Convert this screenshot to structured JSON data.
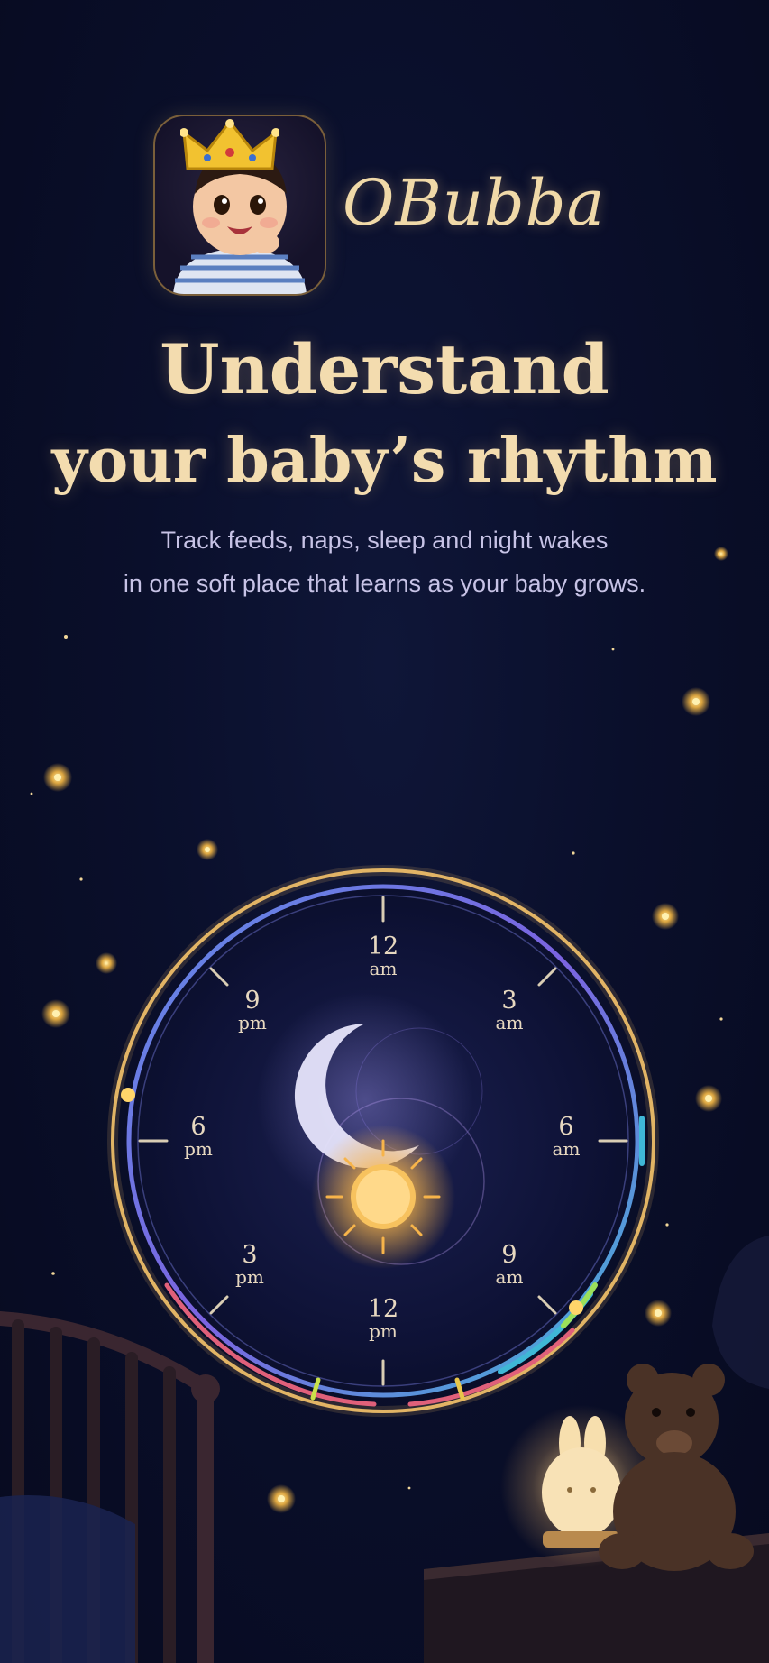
{
  "app": {
    "name": "OBubba"
  },
  "hero": {
    "headline_line1": "Understand",
    "headline_line2": "your baby’s rhythm",
    "subtitle_line1": "Track feeds, naps, sleep and night wakes",
    "subtitle_line2": "in one soft place that learns as your baby grows."
  },
  "clock": {
    "labels": [
      {
        "id": "12am",
        "num": "12",
        "unit": "am"
      },
      {
        "id": "3am",
        "num": "3",
        "unit": "am"
      },
      {
        "id": "6am",
        "num": "6",
        "unit": "am"
      },
      {
        "id": "9am",
        "num": "9",
        "unit": "am"
      },
      {
        "id": "12pm",
        "num": "12",
        "unit": "pm"
      },
      {
        "id": "3pm",
        "num": "3",
        "unit": "pm"
      },
      {
        "id": "6pm",
        "num": "6",
        "unit": "pm"
      },
      {
        "id": "9pm",
        "num": "9",
        "unit": "pm"
      }
    ]
  },
  "colors": {
    "background": "#0a0f2b",
    "gold": "#f3dcaf",
    "subtitle": "#c7c3e6",
    "ring_gold": "#f5c46a",
    "ring_purple": "#7b63e0",
    "ring_pink": "#e0607a",
    "ring_teal": "#3fb7d6"
  },
  "icons": [
    "crown-icon",
    "baby-avatar",
    "moon-icon",
    "sun-icon",
    "firefly-icon",
    "teddy-bear",
    "bunny-nightlight",
    "crib"
  ]
}
